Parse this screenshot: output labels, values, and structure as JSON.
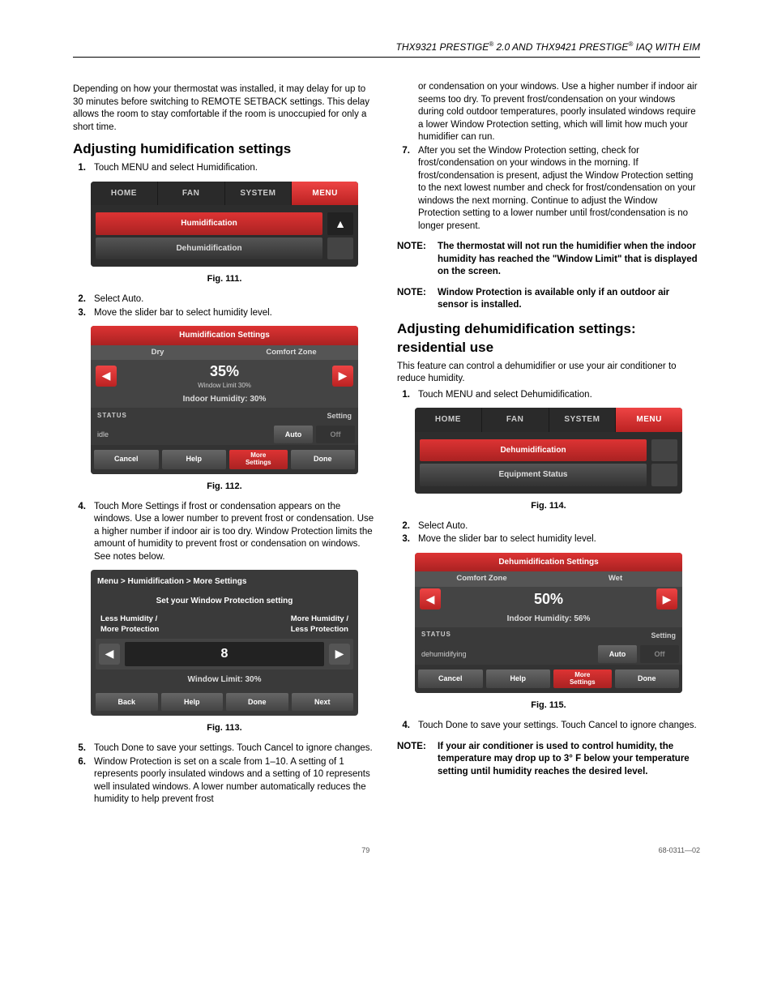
{
  "header": "THX9321 PRESTIGE® 2.0 AND THX9421 PRESTIGE® IAQ WITH EIM",
  "left": {
    "intro": "Depending on how your thermostat was installed, it may delay for up to 30 minutes before switching to REMOTE SETBACK settings. This delay allows the room to stay comfortable if the room is unoccupied for only a short time.",
    "h1": "Adjusting humidification settings",
    "steps1": [
      {
        "n": "1.",
        "t": "Touch MENU and select Humidification."
      }
    ],
    "fig111": {
      "tabs": {
        "home": "HOME",
        "fan": "FAN",
        "system": "SYSTEM",
        "menu": "MENU"
      },
      "row1": "Humidification",
      "row2": "Dehumidification",
      "caption": "Fig. 111."
    },
    "steps2": [
      {
        "n": "2.",
        "t": "Select Auto."
      },
      {
        "n": "3.",
        "t": "Move the slider bar to select humidity level."
      }
    ],
    "fig112": {
      "title": "Humidification Settings",
      "zoneL": "Dry",
      "zoneR": "Comfort Zone",
      "value": "35%",
      "sub": "Window Limit 30%",
      "indoor": "Indoor Humidity: 30%",
      "statusLbl": "STATUS",
      "status": "idle",
      "settingLbl": "Setting",
      "auto": "Auto",
      "off": "Off",
      "cancel": "Cancel",
      "help": "Help",
      "more1": "More",
      "more2": "Settings",
      "done": "Done",
      "caption": "Fig. 112."
    },
    "steps3": [
      {
        "n": "4.",
        "t": "Touch More Settings if frost or condensation appears on the windows. Use a lower number to prevent frost or condensation. Use a higher number if indoor air is too dry. Window Protection limits the amount of humidity to prevent frost or condensation on windows. See notes below."
      }
    ],
    "fig113": {
      "crumb": "Menu > Humidification > More Settings",
      "title": "Set your Window Protection setting",
      "lessL1": "Less Humidity /",
      "lessL2": "More Protection",
      "moreL1": "More Humidity /",
      "moreL2": "Less Protection",
      "value": "8",
      "limit": "Window Limit: 30%",
      "back": "Back",
      "help": "Help",
      "done": "Done",
      "next": "Next",
      "caption": "Fig. 113."
    },
    "steps4": [
      {
        "n": "5.",
        "t": "Touch Done to save your settings. Touch Cancel to ignore changes."
      },
      {
        "n": "6.",
        "t": "Window Protection is set on a scale from 1–10. A setting of 1 represents poorly insulated windows and a setting of 10 represents well insulated windows. A lower number automatically reduces the humidity to help prevent frost"
      }
    ]
  },
  "right": {
    "cont1": "or condensation on your windows. Use a higher number if indoor air seems too dry. To prevent frost/condensation on your windows during cold outdoor temperatures, poorly insulated windows require a lower Window Protection setting, which will limit how much your humidifier can run.",
    "step7": {
      "n": "7.",
      "t": "After you set the Window Protection setting, check for frost/condensation on your windows in the morning. If frost/condensation is present, adjust the Window Protection setting to the next lowest number and check for frost/condensation on your windows the next morning. Continue to adjust the Window Protection setting to a lower number until frost/condensation is no longer present."
    },
    "note1": "The thermostat will not run the humidifier when the indoor humidity has reached the \"Window Limit\" that is displayed on the screen.",
    "note2": "Window Protection is available only if an outdoor air sensor is installed.",
    "h2": "Adjusting dehumidification settings: residential use",
    "p2": "This feature can control a dehumidifier or use your air conditioner to reduce humidity.",
    "steps1": [
      {
        "n": "1.",
        "t": "Touch MENU and select Dehumidification."
      }
    ],
    "fig114": {
      "tabs": {
        "home": "HOME",
        "fan": "FAN",
        "system": "SYSTEM",
        "menu": "MENU"
      },
      "row1": "Dehumidification",
      "row2": "Equipment Status",
      "caption": "Fig. 114."
    },
    "steps2": [
      {
        "n": "2.",
        "t": "Select Auto."
      },
      {
        "n": "3.",
        "t": "Move the slider bar to select humidity level."
      }
    ],
    "fig115": {
      "title": "Dehumidification Settings",
      "zoneL": "Comfort Zone",
      "zoneR": "Wet",
      "value": "50%",
      "indoor": "Indoor Humidity: 56%",
      "statusLbl": "STATUS",
      "status": "dehumidifying",
      "settingLbl": "Setting",
      "auto": "Auto",
      "off": "Off",
      "cancel": "Cancel",
      "help": "Help",
      "more1": "More",
      "more2": "Settings",
      "done": "Done",
      "caption": "Fig. 115."
    },
    "steps3": [
      {
        "n": "4.",
        "t": "Touch Done to save your settings. Touch Cancel to ignore changes."
      }
    ],
    "note3": "If your air conditioner is used to control humidity, the temperature may drop up to 3° F below your temperature setting until humidity reaches the desired level."
  },
  "noteLabel": "NOTE:",
  "footer": {
    "page": "79",
    "doc": "68-0311—02"
  }
}
